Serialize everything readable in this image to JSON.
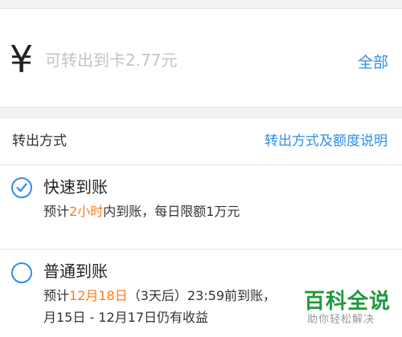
{
  "amount": {
    "currency_symbol": "¥",
    "placeholder": "可转出到卡2.77元",
    "all_label": "全部"
  },
  "method": {
    "header_title": "转出方式",
    "header_link": "转出方式及额度说明",
    "options": [
      {
        "title": "快速到账",
        "selected": true,
        "desc_prefix": "预计",
        "desc_highlight": "2小时",
        "desc_suffix": "内到账，每日限额1万元"
      },
      {
        "title": "普通到账",
        "selected": false,
        "desc_prefix": "预计",
        "desc_highlight": "12月18日",
        "desc_suffix": "（3天后）23:59前到账，",
        "desc_line2": "月15日 - 12月17日仍有收益"
      }
    ]
  },
  "watermark": {
    "main": "百科全说",
    "sub": "助你轻松解决"
  },
  "colors": {
    "accent": "#2d8ee8",
    "highlight": "#ff7a18",
    "watermark": "#1f9a3c"
  }
}
